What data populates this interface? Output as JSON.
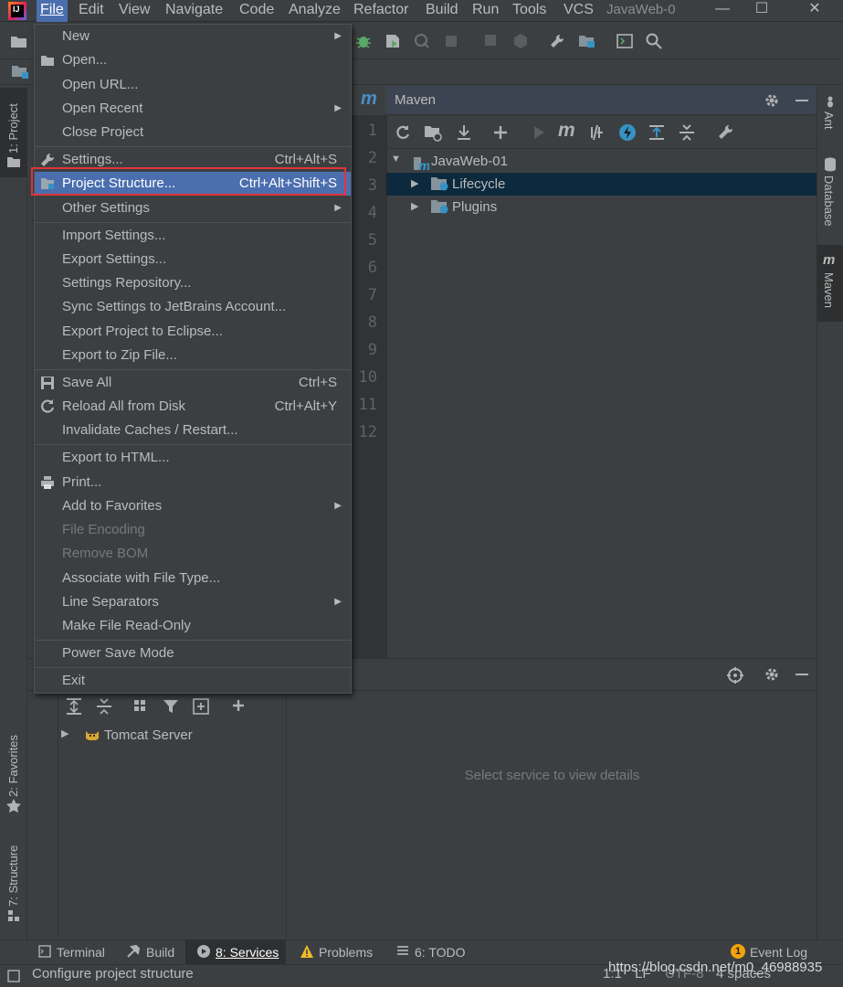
{
  "menubar": {
    "items": [
      {
        "label": "File",
        "mnemonic": "F"
      },
      {
        "label": "Edit",
        "mnemonic": "E"
      },
      {
        "label": "View",
        "mnemonic": "V"
      },
      {
        "label": "Navigate",
        "mnemonic": "N"
      },
      {
        "label": "Code",
        "mnemonic": "C"
      },
      {
        "label": "Analyze",
        "mnemonic": "z"
      },
      {
        "label": "Refactor",
        "mnemonic": "R"
      },
      {
        "label": "Build",
        "mnemonic": "B"
      },
      {
        "label": "Run",
        "mnemonic": "u"
      },
      {
        "label": "Tools",
        "mnemonic": "T"
      },
      {
        "label": "VCS",
        "mnemonic": "S"
      }
    ],
    "window_title": "JavaWeb-0",
    "logo_text": "IJ"
  },
  "file_menu": {
    "items": [
      {
        "label": "New",
        "submenu": true
      },
      {
        "label": "Open...",
        "icon": "folder-open-icon"
      },
      {
        "label": "Open URL..."
      },
      {
        "label": "Open Recent",
        "submenu": true
      },
      {
        "label": "Close Project"
      },
      {
        "label": "Settings...",
        "shortcut": "Ctrl+Alt+S",
        "icon": "wrench-icon"
      },
      {
        "label": "Project Structure...",
        "shortcut": "Ctrl+Alt+Shift+S",
        "icon": "project-structure-icon",
        "selected": true
      },
      {
        "label": "Other Settings",
        "submenu": true
      },
      {
        "label": "Import Settings..."
      },
      {
        "label": "Export Settings..."
      },
      {
        "label": "Settings Repository..."
      },
      {
        "label": "Sync Settings to JetBrains Account..."
      },
      {
        "label": "Export Project to Eclipse..."
      },
      {
        "label": "Export to Zip File..."
      },
      {
        "label": "Save All",
        "shortcut": "Ctrl+S",
        "icon": "save-icon"
      },
      {
        "label": "Reload All from Disk",
        "shortcut": "Ctrl+Alt+Y",
        "icon": "reload-icon"
      },
      {
        "label": "Invalidate Caches / Restart..."
      },
      {
        "label": "Export to HTML..."
      },
      {
        "label": "Print...",
        "icon": "print-icon"
      },
      {
        "label": "Add to Favorites",
        "submenu": true
      },
      {
        "label": "File Encoding",
        "disabled": true
      },
      {
        "label": "Remove BOM",
        "disabled": true
      },
      {
        "label": "Associate with File Type..."
      },
      {
        "label": "Line Separators",
        "submenu": true
      },
      {
        "label": "Make File Read-Only"
      },
      {
        "label": "Power Save Mode"
      },
      {
        "label": "Exit"
      }
    ]
  },
  "editor": {
    "line_numbers": [
      "1",
      "2",
      "3",
      "4",
      "5",
      "6",
      "7",
      "8",
      "9",
      "10",
      "11",
      "12"
    ]
  },
  "maven": {
    "title": "Maven",
    "tree": [
      {
        "label": "JavaWeb-01",
        "expanded": true
      },
      {
        "label": "Lifecycle",
        "expanded": false
      },
      {
        "label": "Plugins",
        "expanded": false
      }
    ]
  },
  "left_tabs": {
    "project": "1: Project",
    "favorites": "2: Favorites",
    "structure": "7: Structure"
  },
  "right_tabs": {
    "ant": "Ant",
    "database": "Database",
    "maven": "Maven"
  },
  "services": {
    "tree_item": "Tomcat Server",
    "empty_text": "Select service to view details"
  },
  "bottom_tabs": {
    "terminal": "Terminal",
    "build": "Build",
    "services": "8: Services",
    "problems": "Problems",
    "todo": "6: TODO",
    "event_log": "Event Log",
    "event_count": "1"
  },
  "statusbar": {
    "text": "Configure project structure",
    "position": "1:1",
    "line_sep": "LF",
    "encoding": "UTF-8",
    "indent": "4 spaces"
  },
  "watermark": "https://blog.csdn.net/m0_46988935",
  "colors": {
    "background": "#3c3f41",
    "selection": "#4b6eaf",
    "highlight_box": "#e0343a",
    "tree_selection": "#0d293e"
  }
}
